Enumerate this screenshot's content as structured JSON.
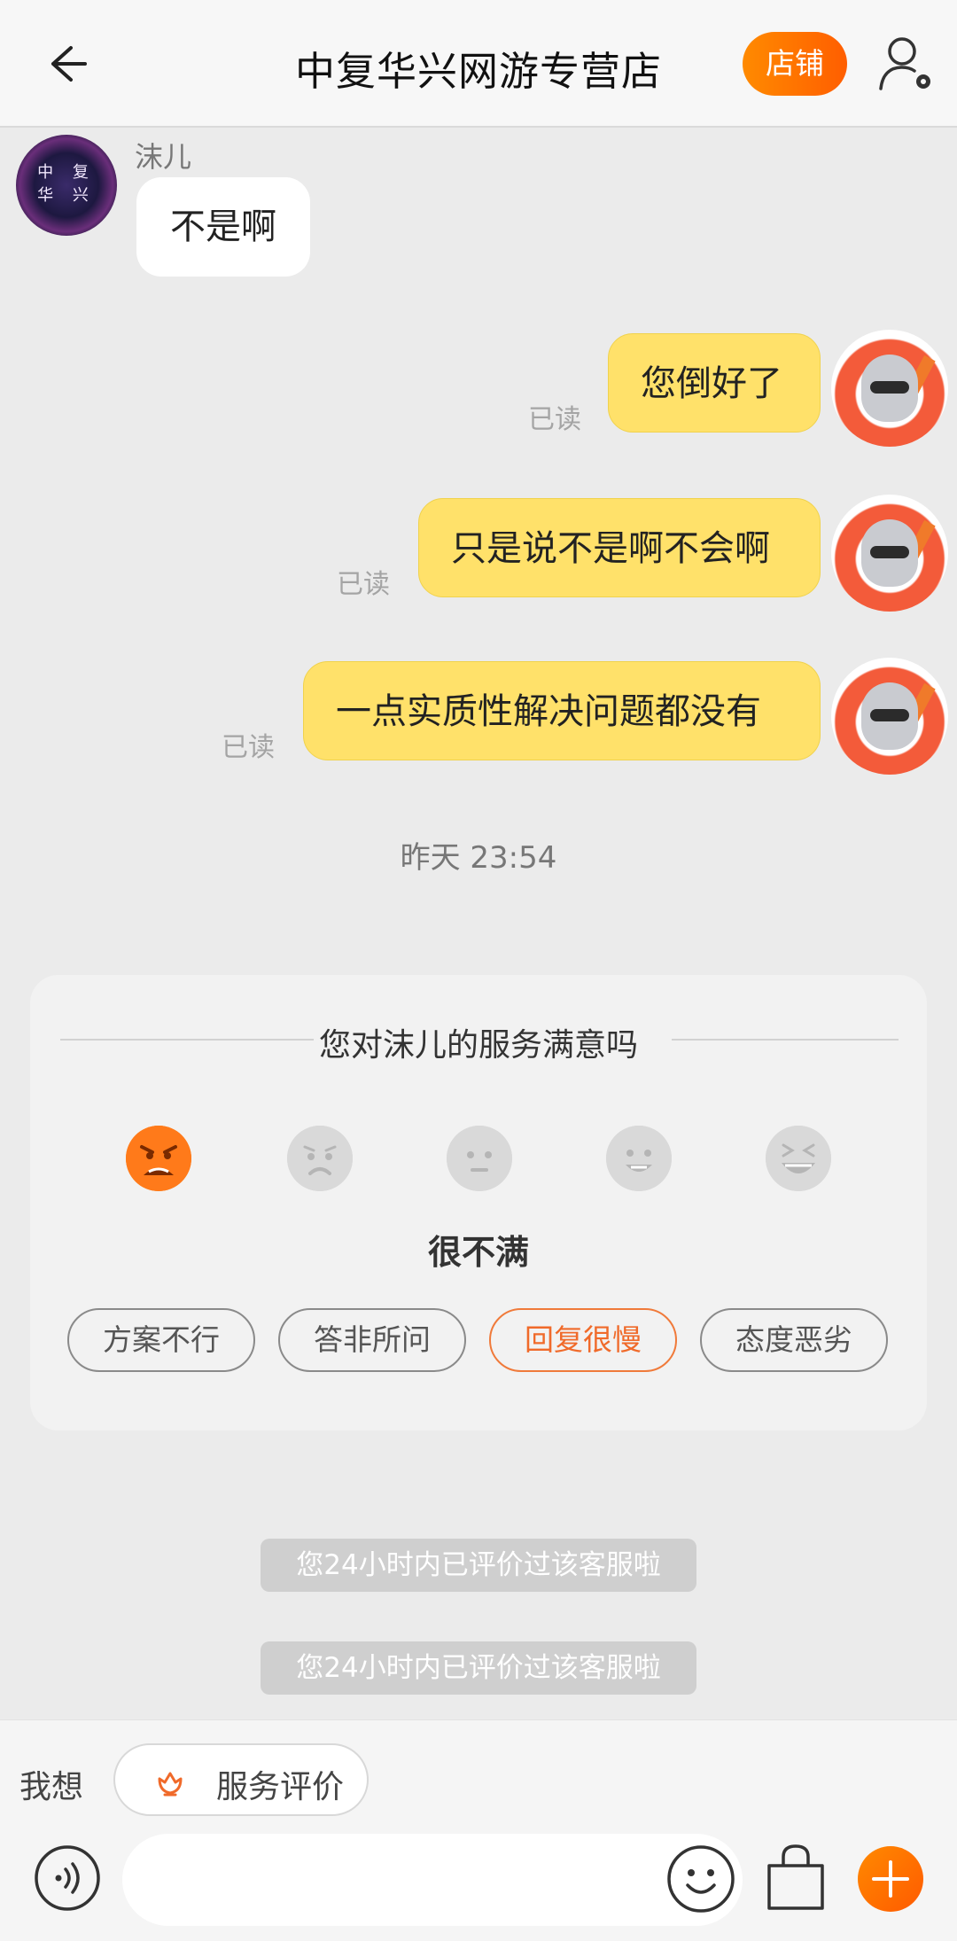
{
  "header": {
    "title": "中复华兴网游专营店",
    "store_button": "店铺"
  },
  "messages": {
    "incoming": {
      "sender": "沫儿",
      "avatar_text_line1": "中 复",
      "avatar_text_line2": "华 兴",
      "text": "不是啊"
    },
    "outgoing": [
      {
        "text": "您倒好了",
        "status": "已读"
      },
      {
        "text": "只是说不是啊不会啊",
        "status": "已读"
      },
      {
        "text": "一点实质性解决问题都没有",
        "status": "已读"
      }
    ],
    "timestamp": "昨天  23:54"
  },
  "rating": {
    "title": "您对沫儿的服务满意吗",
    "selected_label": "很不满",
    "emojis": [
      "very-dissatisfied-icon",
      "dissatisfied-icon",
      "neutral-icon",
      "satisfied-icon",
      "very-satisfied-icon"
    ],
    "tags": [
      "方案不行",
      "答非所问",
      "回复很慢",
      "态度恶劣"
    ],
    "active_tag_index": 2
  },
  "system_messages": [
    "您24小时内已评价过该客服啦",
    "您24小时内已评价过该客服啦"
  ],
  "bottom": {
    "quick_label": "我想",
    "quick_chip": "服务评价",
    "input_placeholder": ""
  },
  "colors": {
    "accent": "#ff6a00",
    "bubble_out": "#ffe16a",
    "active_tag": "#f06a2a"
  }
}
